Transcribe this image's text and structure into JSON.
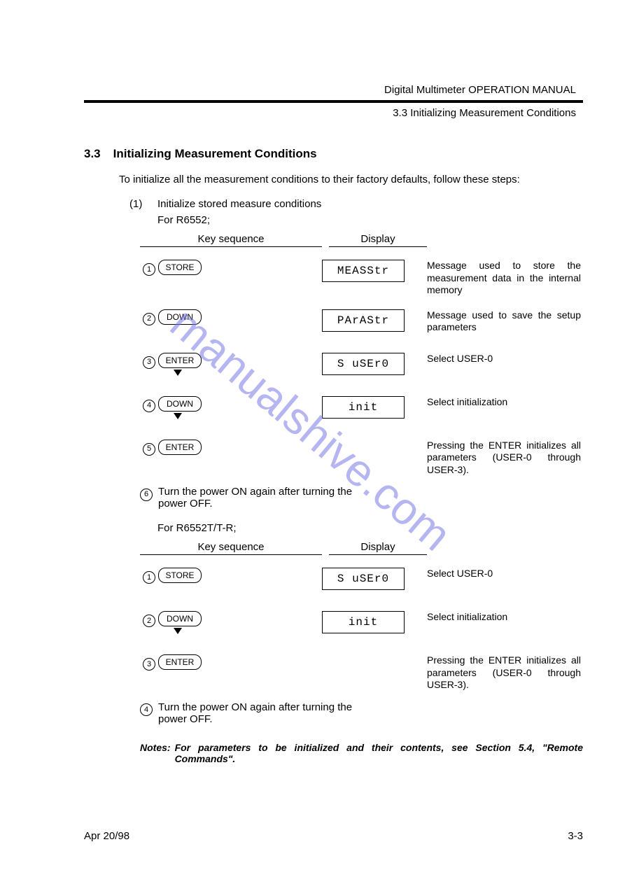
{
  "header": {
    "manual_title": "Digital Multimeter OPERATION MANUAL",
    "running_head": "3.3 Initializing Measurement Conditions"
  },
  "section": {
    "number": "3.3",
    "title": "Initializing Measurement Conditions",
    "intro": "To initialize all the measurement conditions to their factory defaults, follow these steps:",
    "step1_num": "(1)",
    "step1_text": "Initialize stored measure conditions"
  },
  "block_a": {
    "for_label": "For R6552;",
    "col_key": "Key sequence",
    "col_disp": "Display",
    "rows": [
      {
        "n": "1",
        "key": "STORE",
        "tri": false,
        "disp": "MEASStr",
        "desc": "Message used to store the measurement data in the internal memory"
      },
      {
        "n": "2",
        "key": "DOWN",
        "tri": false,
        "disp": "PArAStr",
        "desc": "Message used to save the setup parameters"
      },
      {
        "n": "3",
        "key": "ENTER",
        "tri": true,
        "disp": "S uSEr0",
        "desc": "Select USER-0"
      },
      {
        "n": "4",
        "key": "DOWN",
        "tri": true,
        "disp": "init",
        "desc": "Select initialization"
      },
      {
        "n": "5",
        "key": "ENTER",
        "tri": false,
        "disp": "",
        "desc": "Pressing the ENTER initializes all parameters (USER-0 through USER-3)."
      }
    ],
    "tail_n": "6",
    "tail_text": "Turn the power ON again after turning the power OFF."
  },
  "block_b": {
    "for_label": "For R6552T/T-R;",
    "col_key": "Key sequence",
    "col_disp": "Display",
    "rows": [
      {
        "n": "1",
        "key": "STORE",
        "tri": false,
        "disp": "S uSEr0",
        "desc": "Select USER-0"
      },
      {
        "n": "2",
        "key": "DOWN",
        "tri": true,
        "disp": "init",
        "desc": "Select initialization"
      },
      {
        "n": "3",
        "key": "ENTER",
        "tri": false,
        "disp": "",
        "desc": "Pressing the ENTER initializes all parameters (USER-0 through USER-3)."
      }
    ],
    "tail_n": "4",
    "tail_text": "Turn the power ON again after turning the power OFF."
  },
  "notes": {
    "label": "Notes:",
    "body": "For parameters to be initialized and their contents, see Section 5.4, \"Remote Commands\"."
  },
  "footer": {
    "date": "Apr 20/98",
    "page": "3-3"
  },
  "watermark": "manualshive.com"
}
